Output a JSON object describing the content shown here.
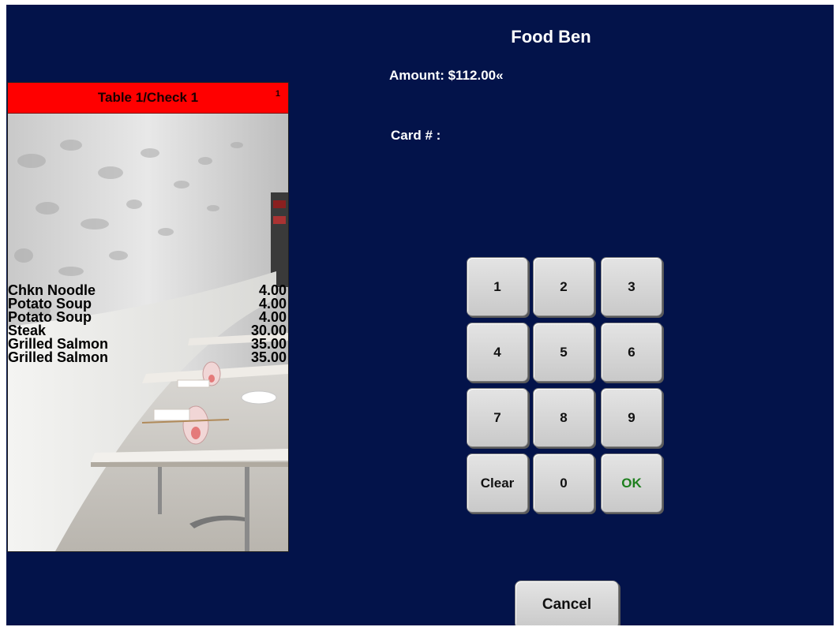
{
  "payment": {
    "title": "Food Ben",
    "amount_text": "Amount: $112.00«",
    "card_label": "Card # :"
  },
  "check": {
    "header": "Table 1/Check 1",
    "count": "1",
    "items": [
      {
        "name": "Chkn Noodle",
        "price": "4.00"
      },
      {
        "name": "Potato Soup",
        "price": "4.00"
      },
      {
        "name": "Potato Soup",
        "price": "4.00"
      },
      {
        "name": "Steak",
        "price": "30.00"
      },
      {
        "name": "Grilled Salmon",
        "price": "35.00"
      },
      {
        "name": "Grilled Salmon",
        "price": "35.00"
      }
    ]
  },
  "keypad": {
    "keys": [
      "1",
      "2",
      "3",
      "4",
      "5",
      "6",
      "7",
      "8",
      "9",
      "Clear",
      "0",
      "OK"
    ]
  },
  "actions": {
    "cancel": "Cancel"
  },
  "colors": {
    "background": "#03134a",
    "header_red": "#ff0000",
    "ok_green": "#1e7f1e"
  }
}
